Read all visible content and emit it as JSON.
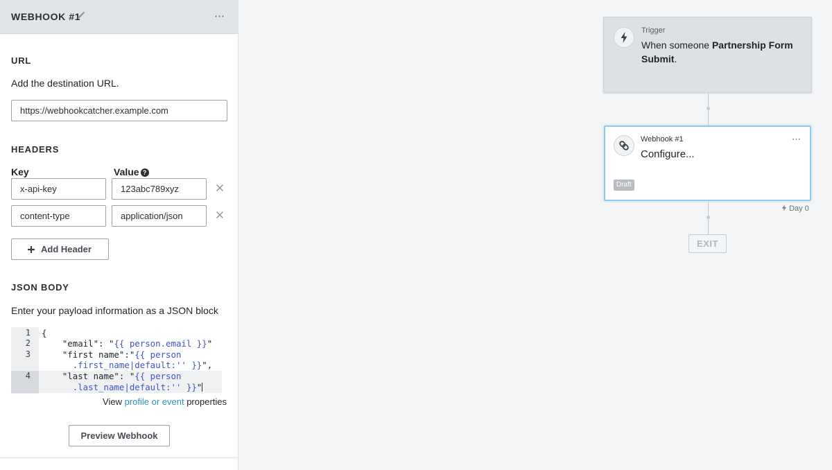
{
  "panel": {
    "title": "WEBHOOK #1",
    "more_label": "⋯",
    "url_section": {
      "title": "URL",
      "help": "Add the destination URL.",
      "value": "https://webhookcatcher.example.com"
    },
    "headers_section": {
      "title": "HEADERS",
      "key_label": "Key",
      "value_label": "Value",
      "help_glyph": "?",
      "rows": [
        {
          "key": "x-api-key",
          "value": "123abc789xyz"
        },
        {
          "key": "content-type",
          "value": "application/json"
        }
      ],
      "add_label": "Add Header"
    },
    "json_section": {
      "title": "JSON BODY",
      "help": "Enter your payload information as a JSON block",
      "line_numbers": [
        "1",
        "2",
        "3",
        "4"
      ],
      "code": {
        "l1": "{",
        "l2_pre": "    \"email\": \"",
        "l2_tpl": "{{ person.email }}",
        "l2_post": "\"",
        "l3_pre": "    \"first name\":\"",
        "l3_tpl": "{{ person",
        "l3b_tpl": "      .first_name|default:'' }}",
        "l3b_post": "\",",
        "l4_pre": "    \"last name\": \"",
        "l4_tpl": "{{ person",
        "l4b_tpl": "      .last_name|default:'' }}",
        "l4b_post": "\""
      },
      "props_prefix": "View ",
      "props_link": "profile or event",
      "props_suffix": " properties"
    },
    "preview_label": "Preview Webhook"
  },
  "canvas": {
    "trigger": {
      "label": "Trigger",
      "text_pre": "When someone ",
      "text_bold": "Partnership Form Submit",
      "text_post": "."
    },
    "webhook": {
      "label": "Webhook #1",
      "configure": "Configure...",
      "more_label": "⋯",
      "badge": "Draft"
    },
    "day_label": "Day 0",
    "exit_label": "EXIT"
  },
  "colors": {
    "accent_link": "#2d8fbd",
    "selected_border": "#8fcbea",
    "template_token": "#3f52c9"
  },
  "icons": [
    "pencil-icon",
    "more-icon",
    "help-icon",
    "close-icon",
    "plus-icon",
    "bolt-icon",
    "link-icon"
  ]
}
